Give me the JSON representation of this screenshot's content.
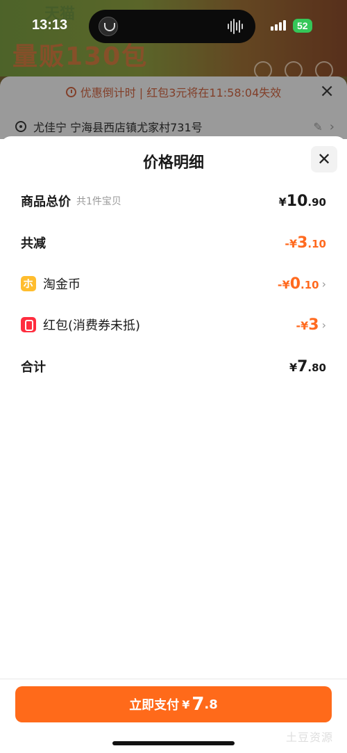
{
  "status_bar": {
    "time": "13:13",
    "battery": "52"
  },
  "background": {
    "banner_text": "量贩130包",
    "banner_subtext": "天猫",
    "countdown_text": "优惠倒计时 | 红包3元将在11:58:04失效",
    "address_text": "尤佳宁 宁海县西店镇尤家村731号"
  },
  "modal": {
    "title": "价格明细",
    "rows": [
      {
        "label": "商品总价",
        "sub": "共1件宝贝",
        "yen": "¥",
        "int": "10",
        "dec": ".90"
      },
      {
        "label": "共减",
        "yen": "-¥",
        "int": "3",
        "dec": ".10"
      },
      {
        "label": "淘金币",
        "yen": "-¥",
        "int": "0",
        "dec": ".10"
      },
      {
        "label": "红包(消费券未抵)",
        "yen": "-¥",
        "int": "3",
        "dec": ""
      },
      {
        "label": "合计",
        "yen": "¥",
        "int": "7",
        "dec": ".80"
      }
    ]
  },
  "pay_button": {
    "label": "立即支付",
    "yen": "¥",
    "int": "7",
    "dec": ".8"
  },
  "watermark": "土豆资源",
  "colors": {
    "accent": "#ff6a1a",
    "discount": "#ff6a1f"
  }
}
